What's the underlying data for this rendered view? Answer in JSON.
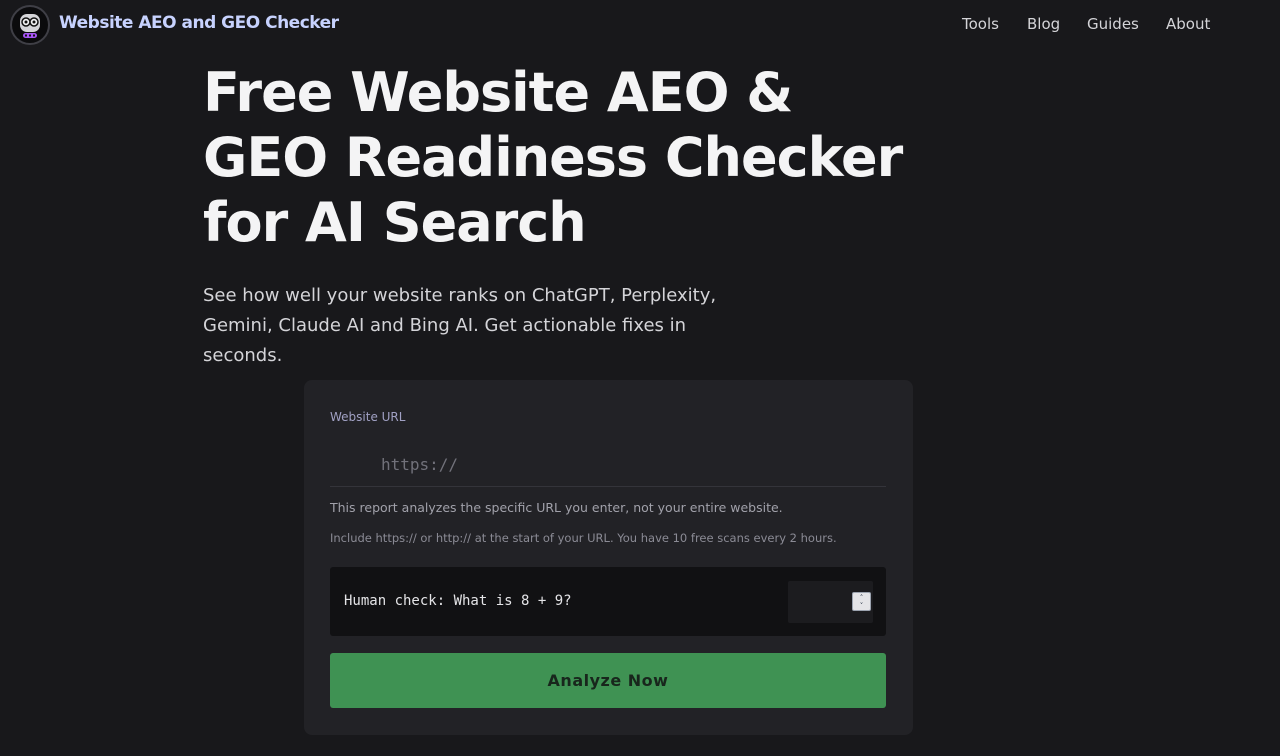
{
  "header": {
    "logo_icon": "robot-face-icon",
    "brand": "Website AEO and GEO Checker",
    "nav": [
      "Tools",
      "Blog",
      "Guides",
      "About"
    ]
  },
  "hero": {
    "title": "Free Website AEO & GEO Readiness Checker for AI Search",
    "subtitle": "See how well your website ranks on ChatGPT, Perplexity, Gemini, Claude AI and Bing AI. Get actionable fixes in seconds."
  },
  "form": {
    "url_label": "Website URL",
    "url_placeholder": "https://",
    "url_value": "",
    "note_scope": "This report analyzes the specific URL you enter, not your entire website.",
    "note_format": "Include https:// or http:// at the start of your URL. You have 10 free scans every 2 hours.",
    "human_check_label": "Human check: What is 8 + 9?",
    "human_check_value": "",
    "submit_label": "Analyze Now"
  },
  "colors": {
    "background": "#18181b",
    "card": "#222226",
    "brand_text": "#c7d2fe",
    "button": "#3f9253"
  }
}
